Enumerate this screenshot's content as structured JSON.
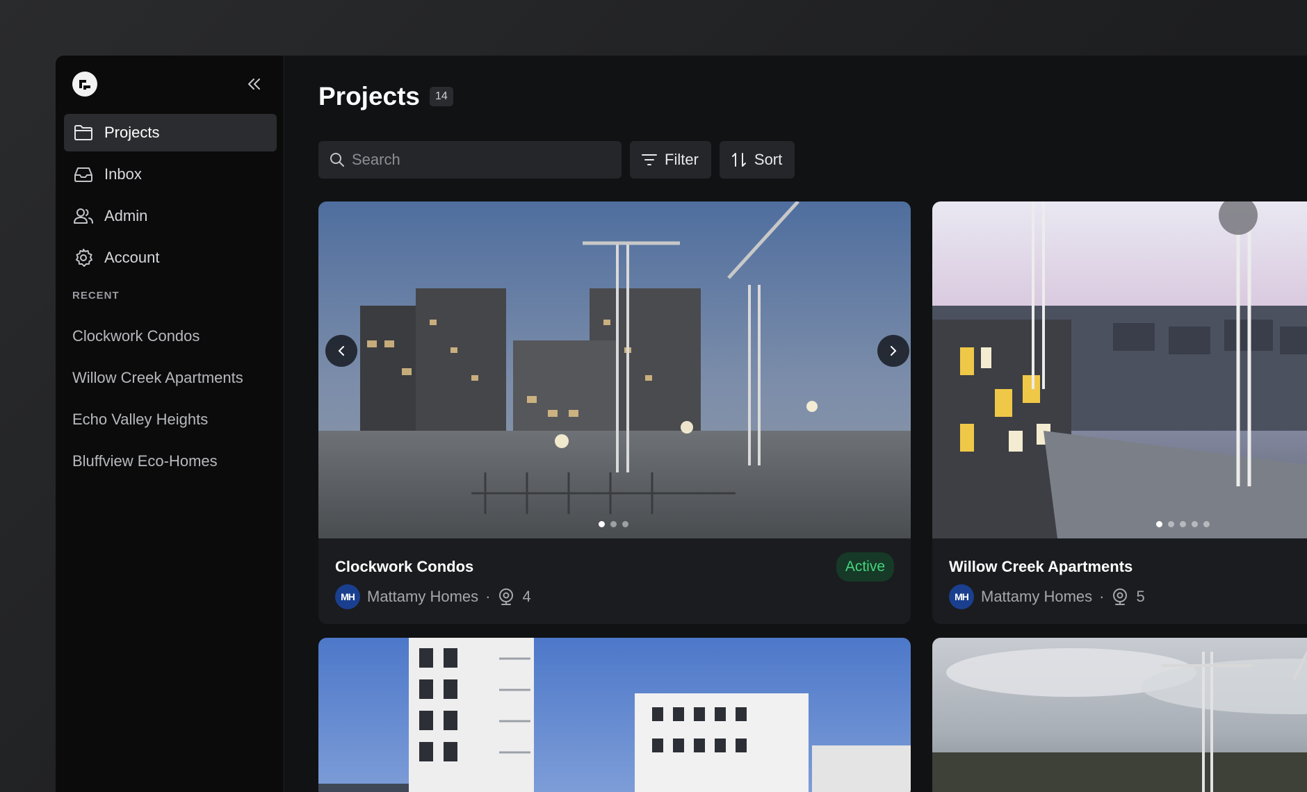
{
  "sidebar": {
    "nav": [
      {
        "label": "Projects",
        "icon": "folder-icon",
        "active": true
      },
      {
        "label": "Inbox",
        "icon": "inbox-icon",
        "active": false
      },
      {
        "label": "Admin",
        "icon": "users-icon",
        "active": false
      },
      {
        "label": "Account",
        "icon": "gear-icon",
        "active": false
      }
    ],
    "recent_heading": "RECENT",
    "recent": [
      {
        "label": "Clockwork Condos"
      },
      {
        "label": "Willow Creek Apartments"
      },
      {
        "label": "Echo Valley Heights"
      },
      {
        "label": "Bluffview Eco-Homes"
      }
    ]
  },
  "header": {
    "title": "Projects",
    "count": "14"
  },
  "toolbar": {
    "search_placeholder": "Search",
    "filter_label": "Filter",
    "sort_label": "Sort"
  },
  "cards": [
    {
      "title": "Clockwork Condos",
      "company": "Mattamy Homes",
      "logo_text": "MH",
      "cameras": "4",
      "status": "Active",
      "separator": "·"
    },
    {
      "title": "Willow Creek Apartments",
      "company": "Mattamy Homes",
      "logo_text": "MH",
      "cameras": "5",
      "separator": "·"
    },
    {
      "title": "",
      "company": ""
    },
    {
      "title": "",
      "company": ""
    }
  ],
  "colors": {
    "status_active": "#46d37e",
    "brand_logo": "#1a3f8f"
  }
}
